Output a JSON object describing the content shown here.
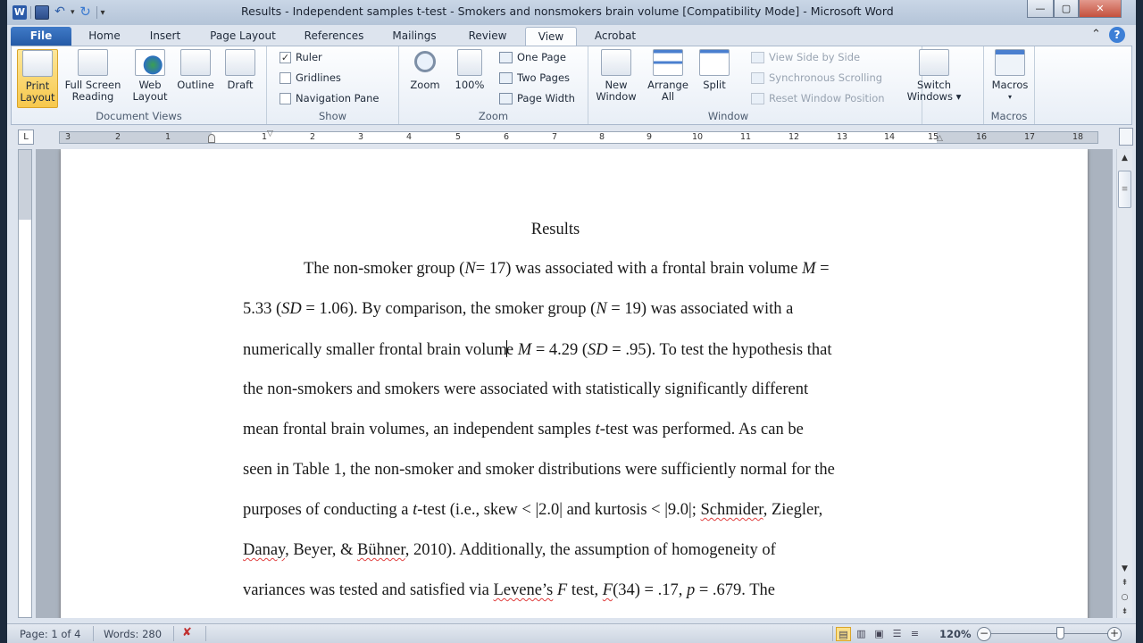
{
  "window": {
    "title": "Results - Independent samples t-test - Smokers and nonsmokers brain volume [Compatibility Mode]  -  Microsoft Word",
    "controls": {
      "minimize": "—",
      "maximize": "▢",
      "close": "✕"
    }
  },
  "qat": {
    "app_icon": "W",
    "save": "save-icon",
    "undo": "undo-icon",
    "redo": "redo-icon",
    "customize": "▾"
  },
  "tabs": [
    {
      "label": "File"
    },
    {
      "label": "Home"
    },
    {
      "label": "Insert"
    },
    {
      "label": "Page Layout"
    },
    {
      "label": "References"
    },
    {
      "label": "Mailings"
    },
    {
      "label": "Review"
    },
    {
      "label": "View",
      "active": true
    },
    {
      "label": "Acrobat"
    }
  ],
  "ribbon": {
    "document_views": {
      "label": "Document Views",
      "buttons": [
        {
          "line1": "Print",
          "line2": "Layout",
          "selected": true
        },
        {
          "line1": "Full Screen",
          "line2": "Reading"
        },
        {
          "line1": "Web",
          "line2": "Layout"
        },
        {
          "line1": "Outline",
          "line2": ""
        },
        {
          "line1": "Draft",
          "line2": ""
        }
      ]
    },
    "show": {
      "label": "Show",
      "items": [
        {
          "label": "Ruler",
          "checked": true
        },
        {
          "label": "Gridlines",
          "checked": false
        },
        {
          "label": "Navigation Pane",
          "checked": false
        }
      ]
    },
    "zoom": {
      "label": "Zoom",
      "zoom_btn": "Zoom",
      "hundred_btn": "100%",
      "one_page": "One Page",
      "two_pages": "Two Pages",
      "page_width": "Page Width"
    },
    "window": {
      "label": "Window",
      "new_window": {
        "line1": "New",
        "line2": "Window"
      },
      "arrange_all": {
        "line1": "Arrange",
        "line2": "All"
      },
      "split": "Split",
      "view_side": "View Side by Side",
      "sync_scroll": "Synchronous Scrolling",
      "reset_pos": "Reset Window Position",
      "switch_windows": {
        "line1": "Switch",
        "line2": "Windows ▾"
      }
    },
    "macros": {
      "label": "Macros",
      "button": "Macros",
      "arrow": "▾"
    },
    "minimize_ribbon": "⌃",
    "help": "?"
  },
  "ruler": {
    "left_numbers": [
      "3",
      "2",
      "1"
    ],
    "right_numbers": [
      "1",
      "2",
      "3",
      "4",
      "5",
      "6",
      "7",
      "8",
      "9",
      "10",
      "11",
      "12",
      "13",
      "14",
      "15",
      "16",
      "17",
      "18"
    ],
    "tab_selector": "L"
  },
  "document": {
    "heading": "Results",
    "lines": [
      [
        {
          "t": "The non-smoker group ("
        },
        {
          "t": "N",
          "i": true
        },
        {
          "t": "= 17) was associated with a  frontal brain volume "
        },
        {
          "t": "M",
          "i": true
        },
        {
          "t": " ="
        }
      ],
      [
        {
          "t": "5.33 ("
        },
        {
          "t": "SD",
          "i": true
        },
        {
          "t": " = 1.06). By comparison, the smoker group ("
        },
        {
          "t": "N",
          "i": true
        },
        {
          "t": " = 19) was associated with a"
        }
      ],
      [
        {
          "t": "numerically smaller  frontal brain volum"
        },
        {
          "caret": true
        },
        {
          "t": "e "
        },
        {
          "t": "M",
          "i": true
        },
        {
          "t": " = 4.29 ("
        },
        {
          "t": "SD",
          "i": true
        },
        {
          "t": " = .95). To test the hypothesis that"
        }
      ],
      [
        {
          "t": "the non-smokers and smokers were associated with statistically significantly different"
        }
      ],
      [
        {
          "t": "mean frontal brain volumes, an independent samples "
        },
        {
          "t": "t",
          "i": true
        },
        {
          "t": "-test was performed. As can be"
        }
      ],
      [
        {
          "t": "seen in Table 1, the non-smoker and smoker distributions were sufficiently normal for the"
        }
      ],
      [
        {
          "t": "purposes of conducting a "
        },
        {
          "t": "t",
          "i": true
        },
        {
          "t": "-test (i.e.,  skew < |2.0| and kurtosis < |9.0|; "
        },
        {
          "t": "Schmider",
          "sq": true
        },
        {
          "t": ", Ziegler,"
        }
      ],
      [
        {
          "t": "Danay",
          "sq": true
        },
        {
          "t": ", Beyer, & "
        },
        {
          "t": "Bühner",
          "sq": true
        },
        {
          "t": ", 2010). Additionally, the assumption of homogeneity of"
        }
      ],
      [
        {
          "t": "variances was tested and satisfied via "
        },
        {
          "t": "Levene’s",
          "sq": true
        },
        {
          "t": " "
        },
        {
          "t": "F",
          "i": true
        },
        {
          "t": " test, "
        },
        {
          "t": "F",
          "i": true,
          "sq": true
        },
        {
          "t": "(34) = .17, "
        },
        {
          "t": "p",
          "i": true
        },
        {
          "t": " = .679. The"
        }
      ]
    ]
  },
  "status": {
    "page": "Page: 1 of 4",
    "words": "Words: 280",
    "zoom_level": "120%",
    "zoom_minus": "−",
    "zoom_plus": "+",
    "zoom_fraction": 0.55
  }
}
